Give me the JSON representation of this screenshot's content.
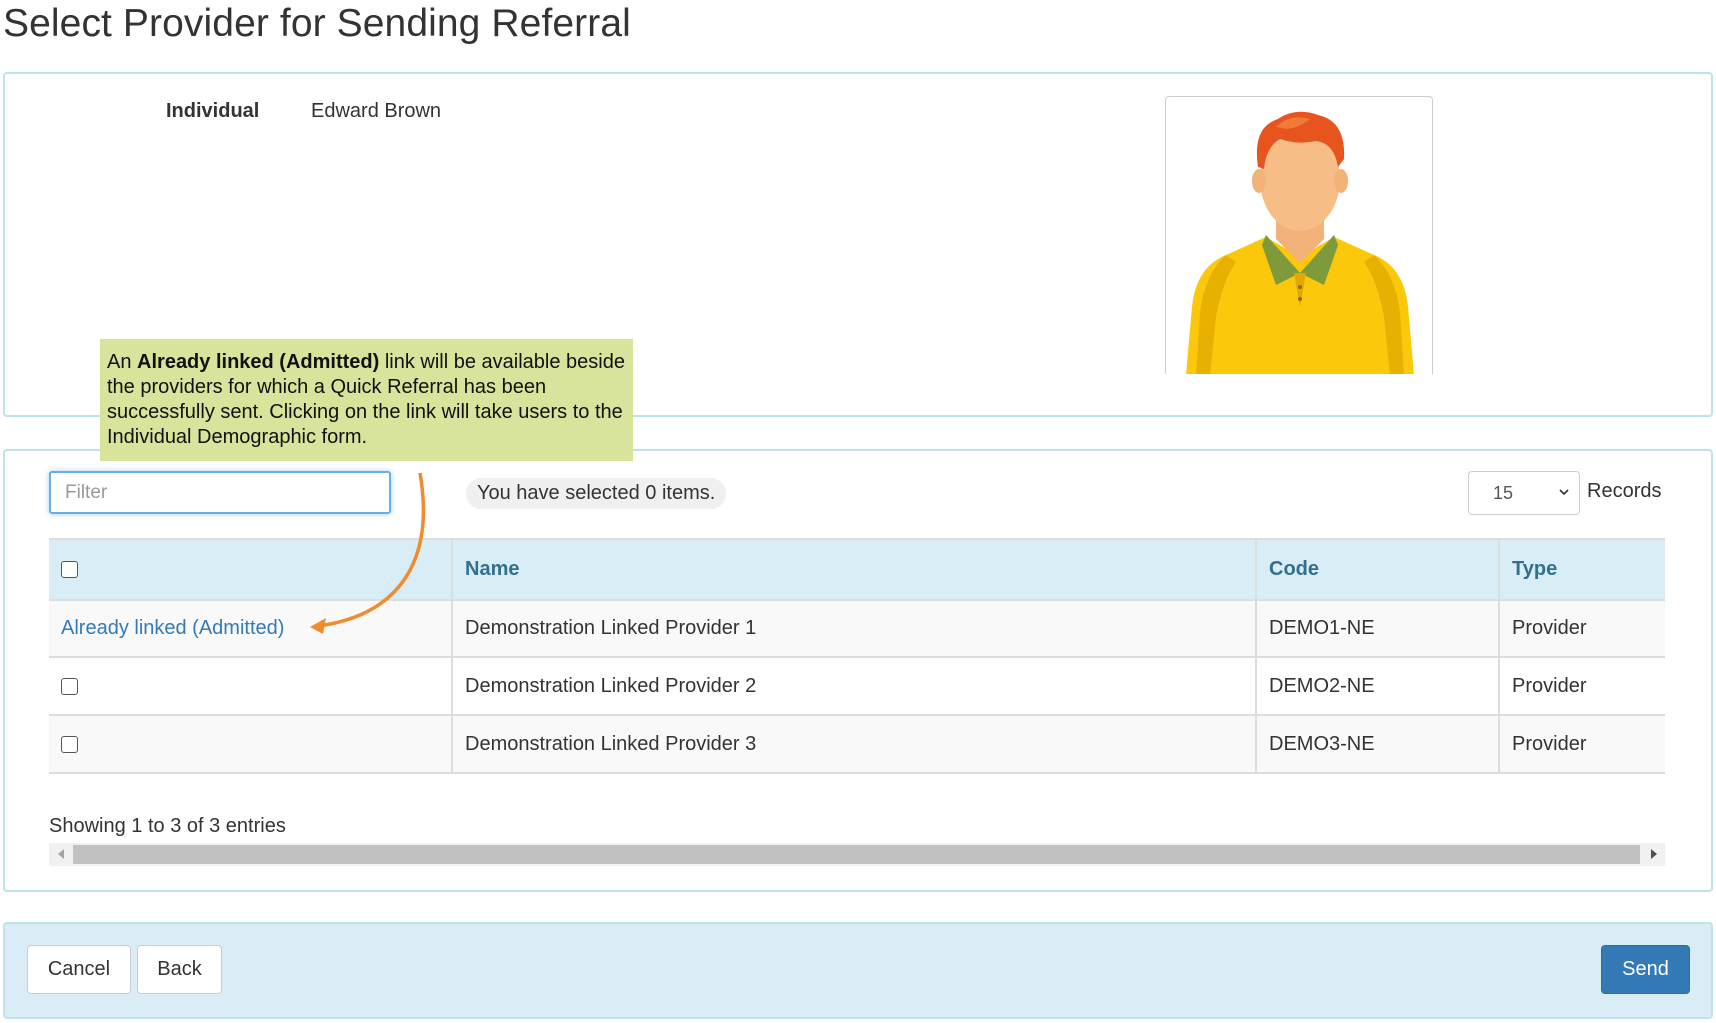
{
  "page": {
    "title": "Select Provider for Sending Referral"
  },
  "individual": {
    "label": "Individual",
    "name": "Edward Brown"
  },
  "callout": {
    "prefix": "An ",
    "bold": "Already linked (Admitted)",
    "suffix": " link will be available beside the providers for which a Quick Referral has been successfully sent. Clicking on the link will take users to the Individual Demographic form."
  },
  "filter": {
    "placeholder": "Filter",
    "value": ""
  },
  "selection": {
    "text": "You have selected 0 items."
  },
  "records": {
    "value": "15",
    "label": "Records"
  },
  "table": {
    "headers": {
      "name": "Name",
      "code": "Code",
      "type": "Type"
    },
    "rows": [
      {
        "link": "Already linked (Admitted)",
        "name": "Demonstration Linked Provider 1",
        "code": "DEMO1-NE",
        "type": "Provider"
      },
      {
        "name": "Demonstration Linked Provider 2",
        "code": "DEMO2-NE",
        "type": "Provider"
      },
      {
        "name": "Demonstration Linked Provider 3",
        "code": "DEMO3-NE",
        "type": "Provider"
      }
    ]
  },
  "footer": {
    "showing": "Showing 1 to 3 of 3 entries"
  },
  "actions": {
    "cancel": "Cancel",
    "back": "Back",
    "send": "Send"
  },
  "colors": {
    "accent": "#337ab7",
    "header_bg": "#d9edf7",
    "callout_bg": "#d8e39c",
    "arrow": "#f28a2e"
  },
  "icons": {
    "avatar": "person-avatar-icon",
    "dropdown": "chevron-down-icon"
  }
}
